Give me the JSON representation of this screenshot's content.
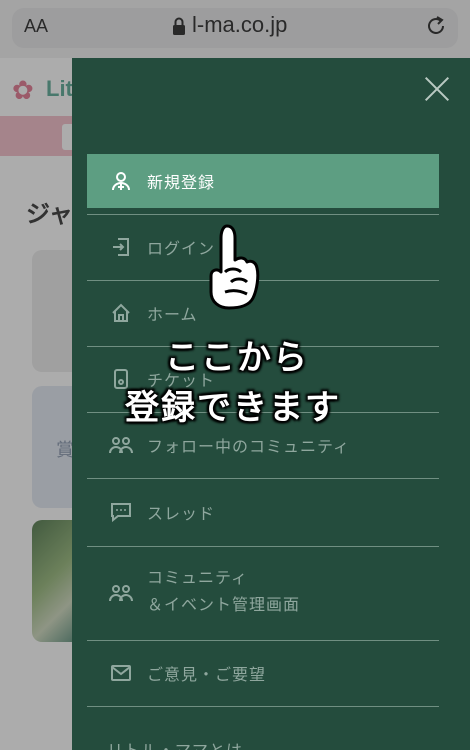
{
  "browser": {
    "text_size_label": "AA",
    "url": "l-ma.co.jp"
  },
  "background_page": {
    "logo_text": "Lit",
    "heading": "ジャ",
    "card_text": "賞"
  },
  "drawer": {
    "items": [
      {
        "label": "新規登録",
        "icon": "person-add-icon"
      },
      {
        "label": "ログイン",
        "icon": "login-icon"
      },
      {
        "label": "ホーム",
        "icon": "home-icon"
      },
      {
        "label": "チケット",
        "icon": "ticket-icon"
      },
      {
        "label": "フォロー中のコミュニティ",
        "icon": "group-icon"
      },
      {
        "label": "スレッド",
        "icon": "chat-bubble-icon"
      },
      {
        "label_line1": "コミュニティ",
        "label_line2": "＆イベント管理画面",
        "icon": "group-icon"
      },
      {
        "label": "ご意見・ご要望",
        "icon": "mail-icon"
      },
      {
        "label": "リトル・ママとは"
      }
    ]
  },
  "annotation": {
    "line1": "ここから",
    "line2": "登録できます"
  },
  "colors": {
    "drawer_bg": "#244c3d",
    "active_item": "#5d9e82",
    "menu_text": "#8fa79e"
  }
}
